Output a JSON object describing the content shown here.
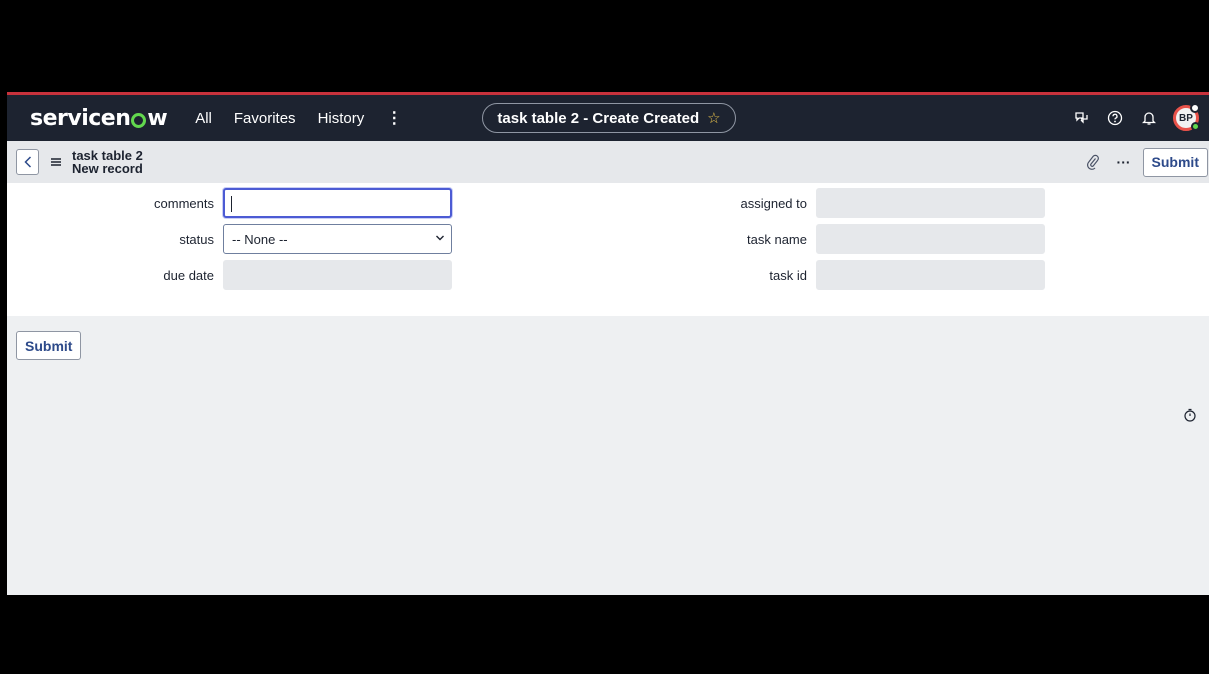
{
  "nav": {
    "brand": "servicenow",
    "items": [
      "All",
      "Favorites",
      "History"
    ],
    "more": "⋮",
    "title": "task table 2 - Create Created",
    "avatar_initials": "BP"
  },
  "header": {
    "table_name": "task table 2",
    "record_label": "New record",
    "more": "···",
    "submit_label": "Submit"
  },
  "form": {
    "left_fields": [
      {
        "label": "comments",
        "value": "",
        "type": "text"
      },
      {
        "label": "status",
        "value": "-- None --",
        "type": "select"
      },
      {
        "label": "due date",
        "value": "",
        "type": "readonly"
      }
    ],
    "right_fields": [
      {
        "label": "assigned to",
        "value": "",
        "type": "readonly"
      },
      {
        "label": "task name",
        "value": "",
        "type": "readonly"
      },
      {
        "label": "task id",
        "value": "",
        "type": "readonly"
      }
    ]
  },
  "footer": {
    "submit_label": "Submit"
  },
  "colors": {
    "nav_bg": "#1d2330",
    "accent_red": "#c8323c",
    "brand_green": "#62d84e",
    "button_text": "#2d4a8a"
  },
  "icons": [
    "chat-icon",
    "help-icon",
    "bell-icon",
    "back-icon",
    "hamburger-icon",
    "paperclip-icon",
    "star-icon",
    "timer-icon"
  ]
}
